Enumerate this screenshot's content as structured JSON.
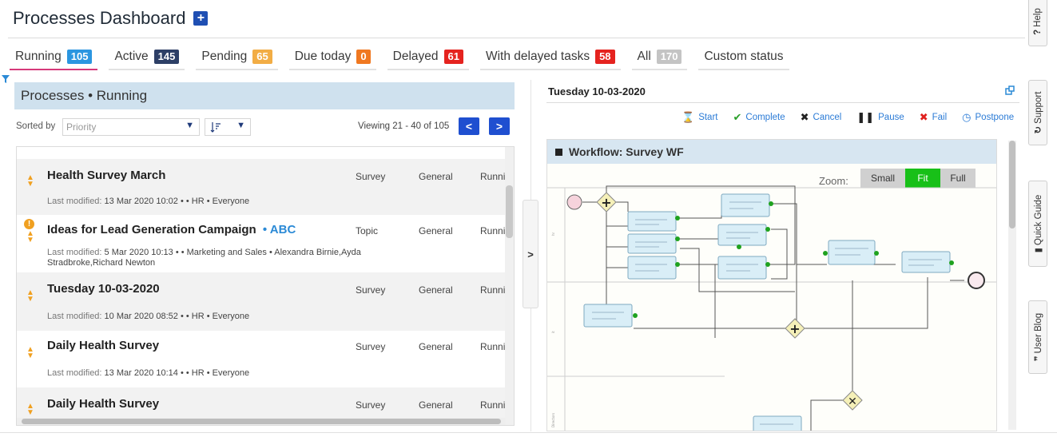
{
  "header": {
    "title": "Processes Dashboard",
    "add_icon": "plus-square-icon"
  },
  "tabs": [
    {
      "label": "Running",
      "count": "105",
      "color": "#2b96e0"
    },
    {
      "label": "Active",
      "count": "145",
      "color": "#2d3f66"
    },
    {
      "label": "Pending",
      "count": "65",
      "color": "#f2ad45"
    },
    {
      "label": "Due today",
      "count": "0",
      "color": "#f07820"
    },
    {
      "label": "Delayed",
      "count": "61",
      "color": "#e5231f"
    },
    {
      "label": "With delayed tasks",
      "count": "58",
      "color": "#e5231f"
    },
    {
      "label": "All",
      "count": "170",
      "color": "#c4c4c4"
    },
    {
      "label": "Custom status"
    }
  ],
  "list_panel": {
    "title": "Processes • Running",
    "sorted_by_label": "Sorted by",
    "sort_field": "Priority",
    "sort_dir_icon": "sort-desc-icon",
    "viewing": "Viewing 21 - 40 of 105",
    "prev_icon": "chevron-left-icon",
    "next_icon": "chevron-right-icon",
    "rows": [
      {
        "title": "Health Survey March",
        "tag": "",
        "last_modified_label": "Last modified:",
        "meta": "13 Mar 2020 10:02 •  • HR • Everyone",
        "type": "Survey",
        "category": "General",
        "status": "Runni"
      },
      {
        "title": "Ideas for Lead Generation Campaign",
        "tag": "ABC",
        "last_modified_label": "Last modified:",
        "meta": "5 Mar 2020 10:13 •  • Marketing and Sales • Alexandra Birnie,Ayda Stradbroke,Richard Newton",
        "type": "Topic",
        "category": "General",
        "status": "Runni"
      },
      {
        "title": "Tuesday 10-03-2020",
        "tag": "",
        "last_modified_label": "Last modified:",
        "meta": "10 Mar 2020 08:52 •  • HR • Everyone",
        "type": "Survey",
        "category": "General",
        "status": "Runni"
      },
      {
        "title": "Daily Health Survey",
        "tag": "",
        "last_modified_label": "Last modified:",
        "meta": "13 Mar 2020 10:14 •  • HR • Everyone",
        "type": "Survey",
        "category": "General",
        "status": "Runni"
      },
      {
        "title": "Daily Health Survey",
        "tag": "",
        "last_modified_label": "",
        "meta": "",
        "type": "Survey",
        "category": "General",
        "status": "Runni"
      }
    ]
  },
  "detail_panel": {
    "title": "Tuesday 10-03-2020",
    "actions": [
      {
        "label": "Start",
        "icon": "hourglass-icon",
        "color": "#2b7bd6"
      },
      {
        "label": "Complete",
        "icon": "check-icon",
        "color": "#2aa02a"
      },
      {
        "label": "Cancel",
        "icon": "x-icon",
        "color": "#222222"
      },
      {
        "label": "Pause",
        "icon": "pause-icon",
        "color": "#222222"
      },
      {
        "label": "Fail",
        "icon": "x-icon",
        "color": "#e0201e"
      },
      {
        "label": "Postpone",
        "icon": "clock-icon",
        "color": "#2b7bd6"
      }
    ],
    "workflow_title": "Workflow: Survey WF",
    "zoom_label": "Zoom:",
    "zoom_options": [
      "Small",
      "Fit",
      "Full"
    ],
    "zoom_selected": "Fit"
  },
  "side_tabs": [
    {
      "label": "Help",
      "icon": "?"
    },
    {
      "label": "Support",
      "icon": "support-icon"
    },
    {
      "label": "Quick Guide",
      "icon": "book-icon"
    },
    {
      "label": "User Blog",
      "icon": "quote-icon"
    }
  ]
}
